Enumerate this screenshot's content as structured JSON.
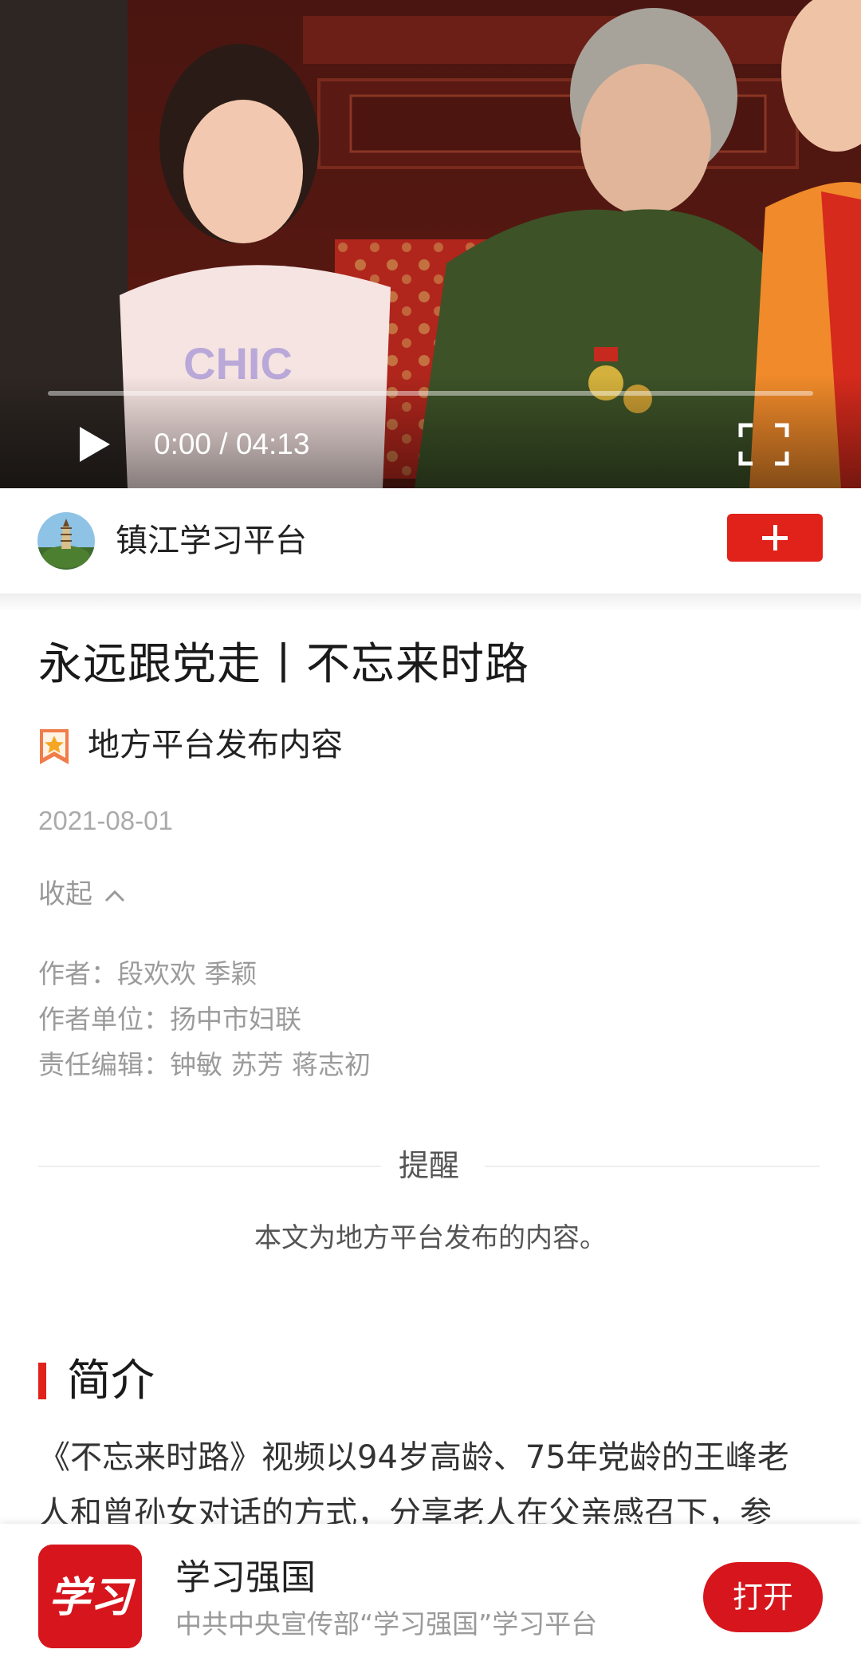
{
  "video": {
    "time_display": "0:00 / 04:13",
    "progress": 0,
    "play_icon": "play-icon",
    "fullscreen_icon": "fullscreen-icon",
    "watermark_text": "CHIC"
  },
  "account": {
    "name": "镇江学习平台",
    "follow_icon": "plus-icon",
    "accent_color": "#e0221a"
  },
  "article": {
    "title": "永远跟党走丨不忘来时路",
    "source_label": "地方平台发布内容",
    "date": "2021-08-01",
    "collapse_label": "收起",
    "meta": [
      "作者：段欢欢 季颖",
      "作者单位：扬中市妇联",
      "责任编辑：钟敏 苏芳 蒋志初"
    ]
  },
  "reminder": {
    "title": "提醒",
    "text": "本文为地方平台发布的内容。"
  },
  "intro": {
    "heading": "简介",
    "lines": [
      "《不忘来时路》视频以94岁高龄、75年党龄的王峰老",
      "人和曾孙女对话的方式，分享老人在父亲感召下，参"
    ]
  },
  "app_banner": {
    "name": "学习强国",
    "description": "中共中央宣传部“学习强国”学习平台",
    "open_label": "打开",
    "logo_text": "学习",
    "brand_color": "#d6161c"
  }
}
